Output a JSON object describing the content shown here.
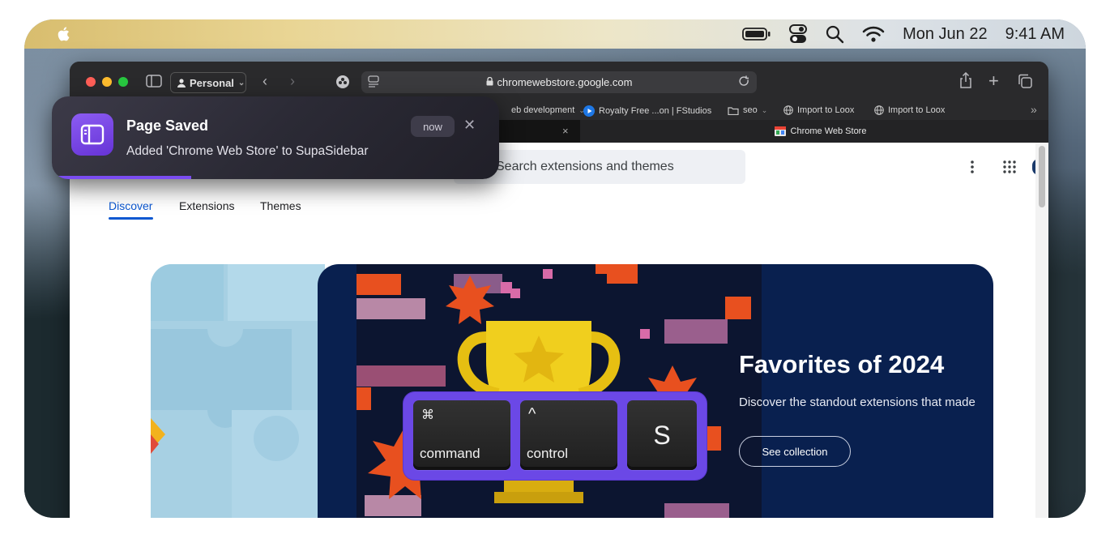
{
  "menubar": {
    "date": "Mon Jun 22",
    "time": "9:41 AM",
    "icons": [
      "apple-icon",
      "battery-icon",
      "control-center-icon",
      "search-icon",
      "wifi-icon"
    ]
  },
  "browser": {
    "profile_label": "Personal",
    "url": "chromewebstore.google.com",
    "bookmarks": [
      {
        "label": "eb development",
        "icon": "chevron-down-icon"
      },
      {
        "label": "Royalty Free ...on | FStudios",
        "icon": "play-icon"
      },
      {
        "label": "seo",
        "icon": "folder-icon"
      },
      {
        "label": "Import to Loox",
        "icon": "globe-icon"
      },
      {
        "label": "Import to Loox",
        "icon": "globe-icon"
      }
    ],
    "active_tab_title": "Chrome Web Store",
    "tab_close": "×"
  },
  "store": {
    "search_placeholder": "Search extensions and themes",
    "nav": [
      "Discover",
      "Extensions",
      "Themes"
    ],
    "hero": {
      "title": "Favorites of 2024",
      "subtitle": "Discover the standout extensions that made",
      "button": "See collection"
    }
  },
  "notification": {
    "title": "Page Saved",
    "body": "Added 'Chrome Web Store' to SupaSidebar",
    "time": "now",
    "close": "✕",
    "accent": "#7a4cf0"
  },
  "keys": [
    {
      "symbol": "⌘",
      "name": "command"
    },
    {
      "symbol": "^",
      "name": "control"
    },
    {
      "symbol": "",
      "name": "S"
    }
  ]
}
